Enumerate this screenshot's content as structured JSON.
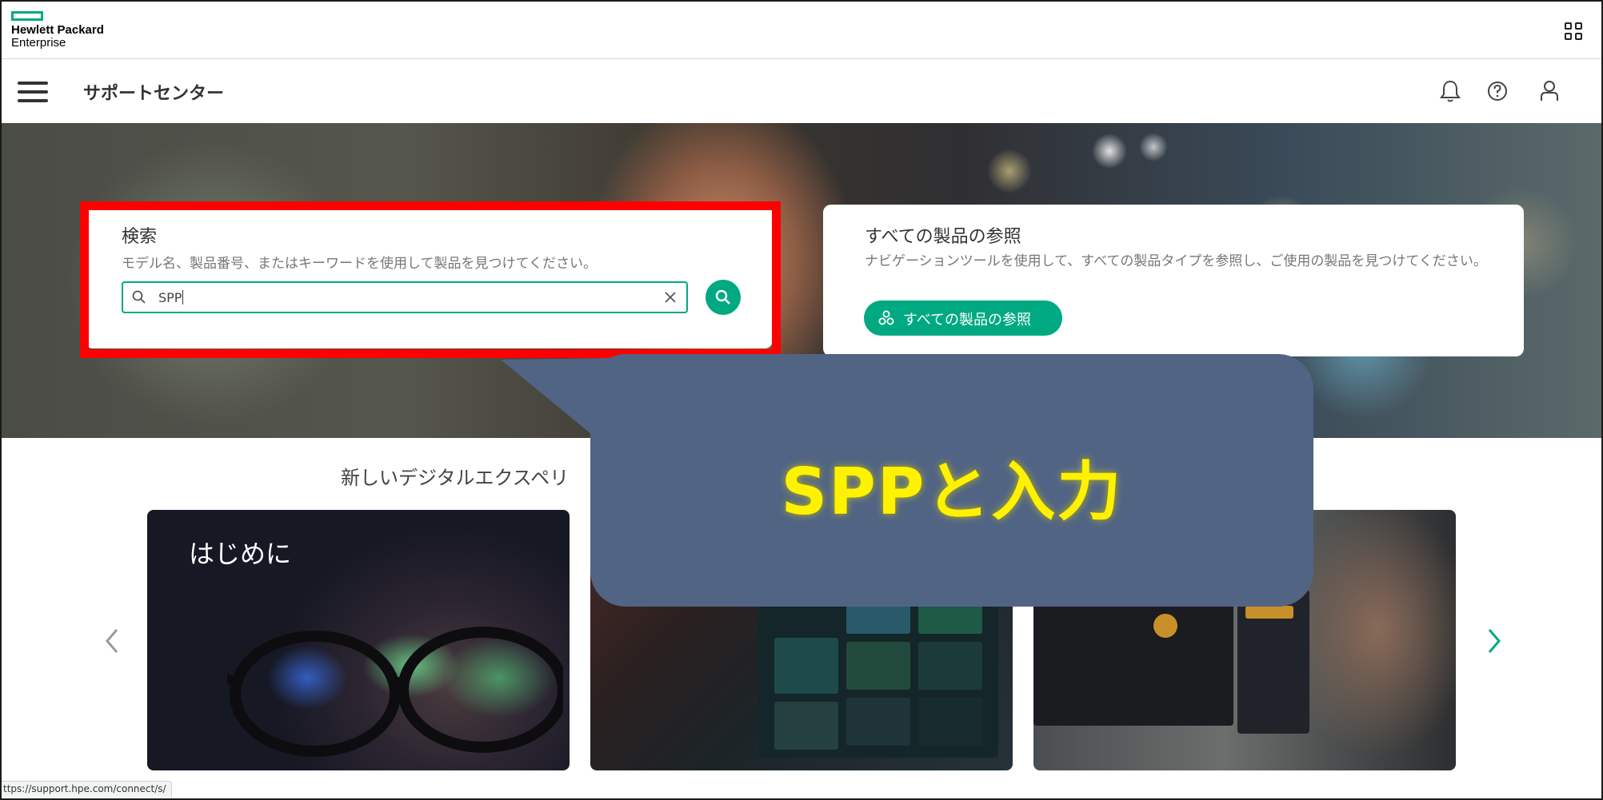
{
  "brand": {
    "line1": "Hewlett Packard",
    "line2": "Enterprise",
    "accent_color": "#01a982"
  },
  "nav": {
    "title": "サポートセンター",
    "icons": [
      "menu-icon",
      "bell-icon",
      "help-icon",
      "user-icon",
      "apps-grid-icon"
    ]
  },
  "search": {
    "title": "検索",
    "description": "モデル名、製品番号、またはキーワードを使用して製品を見つけてください。",
    "value": "SPP"
  },
  "browse": {
    "title": "すべての製品の参照",
    "description": "ナビゲーションツールを使用して、すべての製品タイプを参照し、ご使用の製品を見つけてください。",
    "button_label": "すべての製品の参照"
  },
  "section": {
    "title": "新しいデジタルエクスペリ",
    "cards": [
      {
        "label": "はじめに"
      }
    ]
  },
  "callout": {
    "text": "SPPと入力",
    "background": "#516484",
    "text_color": "#fff200"
  },
  "highlight_color": "#ff0000",
  "status_url": "ttps://support.hpe.com/connect/s/"
}
